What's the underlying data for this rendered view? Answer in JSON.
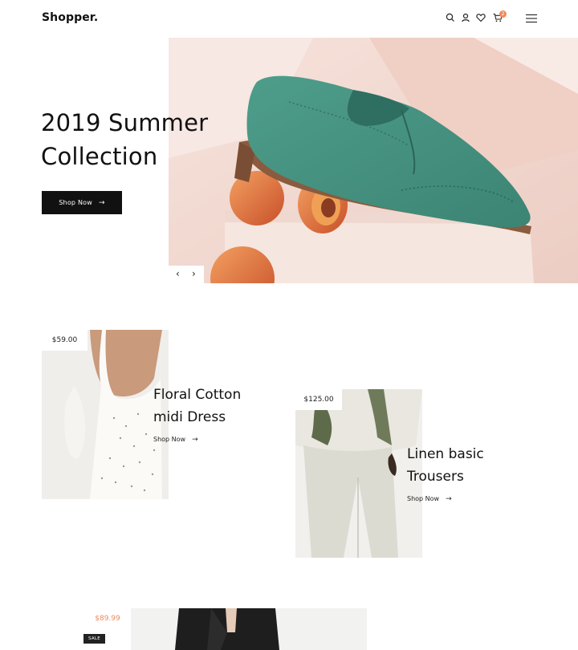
{
  "header": {
    "logo": "Shopper.",
    "cart_count": "2",
    "icons": [
      "search-icon",
      "user-icon",
      "heart-icon",
      "cart-icon",
      "menu-icon"
    ]
  },
  "hero": {
    "title_line1": "2019 Summer",
    "title_line2": "Collection",
    "button_label": "Shop Now",
    "button_arrow": "→",
    "prev": "‹",
    "next": "›"
  },
  "products": [
    {
      "price": "$59.00",
      "name_line1": "Floral Cotton",
      "name_line2": "midi Dress",
      "link": "Shop Now",
      "arrow": "→"
    },
    {
      "price": "$125.00",
      "name_line1": "Linen basic",
      "name_line2": "Trousers",
      "link": "Shop Now",
      "arrow": "→"
    },
    {
      "price": "$89.99",
      "badge": "SALE"
    }
  ],
  "colors": {
    "accent": "#ef8a5b",
    "dark": "#111111",
    "hero_bg": "#f3dcd3"
  }
}
